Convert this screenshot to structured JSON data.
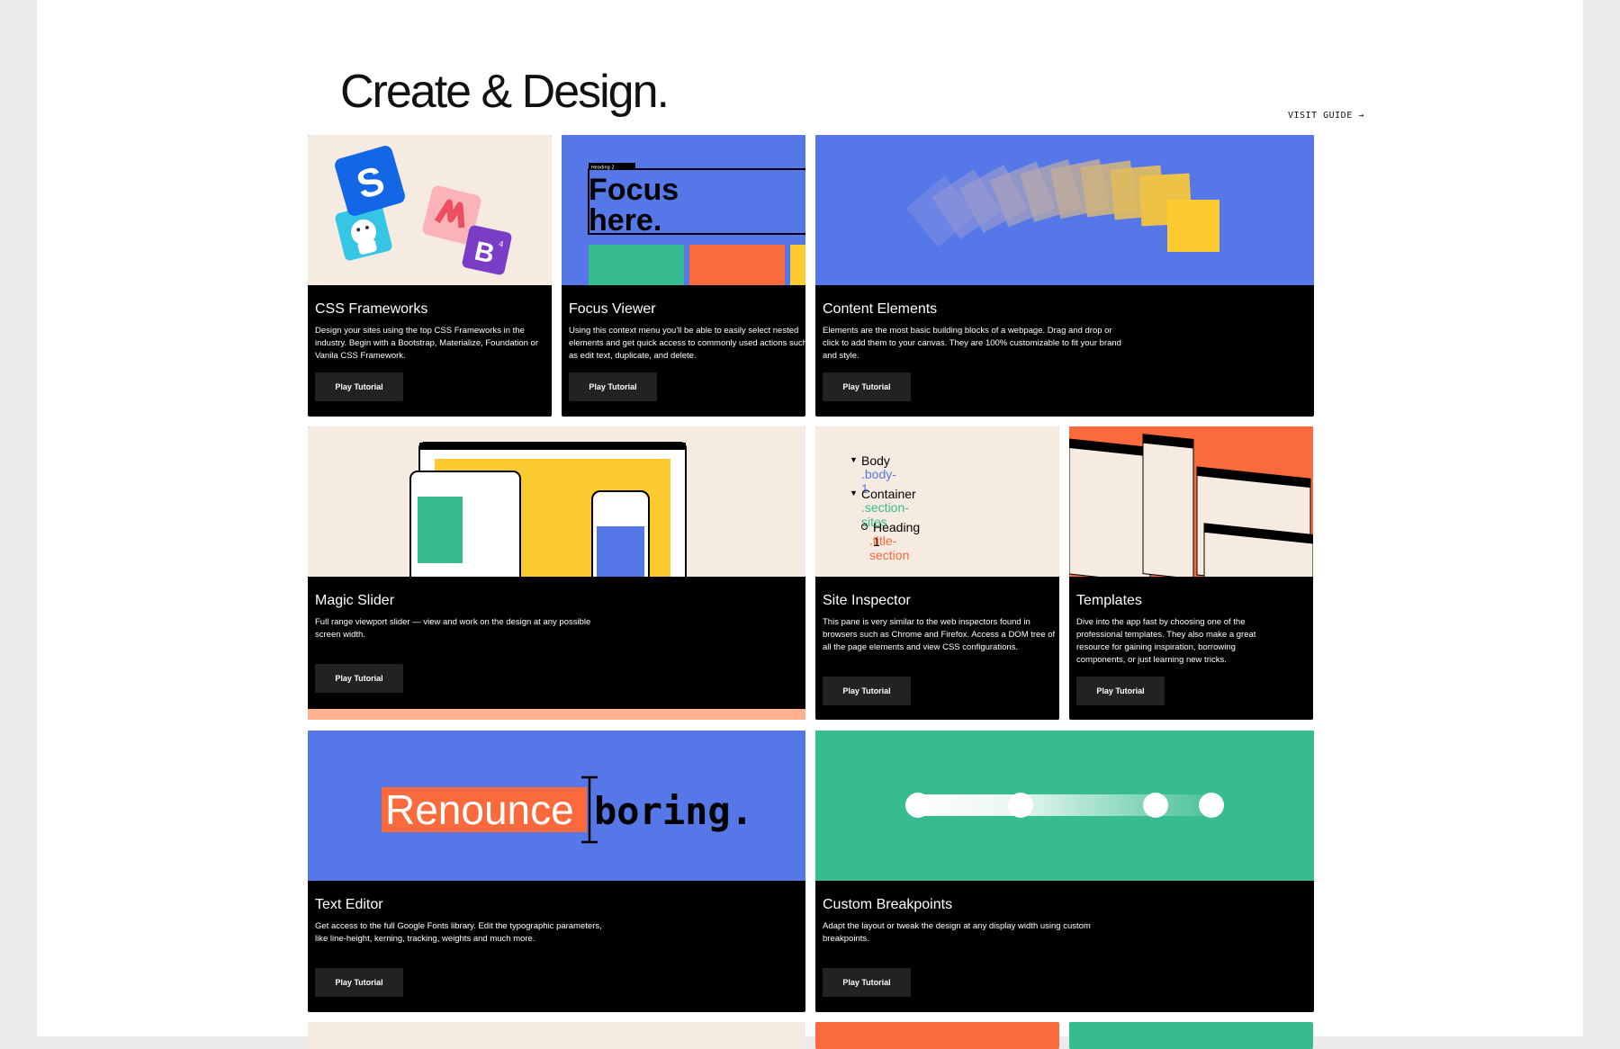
{
  "page": {
    "title": "Create & Design.",
    "visit_guide": "VISIT GUIDE →"
  },
  "cards": [
    {
      "title": "CSS Frameworks",
      "description": "Design your sites using the top CSS Frameworks in the industry. Begin with a Bootstrap, Materialize, Foundation or Vanila CSS Framework.",
      "button": "Play Tutorial",
      "hero": {
        "icons": [
          "S",
          "M",
          "B"
        ],
        "bootstrap_superscript": "4"
      }
    },
    {
      "title": "Focus Viewer",
      "description": "Using this context menu you'll be able to easily select nested elements and get quick access to commonly used actions such as edit text, duplicate, and delete.",
      "button": "Play Tutorial",
      "hero": {
        "focus_line1": "Focus",
        "focus_line2": "here.",
        "toolbar_label": "Heading 2"
      }
    },
    {
      "title": "Content Elements",
      "description": "Elements are the most basic building blocks of a webpage. Drag and drop or click to add them to your canvas. They are 100% customizable to fit your brand and style.",
      "button": "Play Tutorial"
    },
    {
      "title": "Magic Slider",
      "description": "Full range viewport slider — view and work on the design at any possible screen width.",
      "button": "Play Tutorial"
    },
    {
      "title": "Site Inspector",
      "description": "This pane is very similar to the web inspectors found in browsers such as Chrome and Firefox. Access a DOM tree of all the page elements and view CSS configurations.",
      "button": "Play Tutorial",
      "hero": {
        "tree": [
          {
            "name": "Body",
            "cls": ".body-1"
          },
          {
            "name": "Container",
            "cls": ".section-sites"
          },
          {
            "name": "Heading 1",
            "cls": ".title-section"
          }
        ]
      }
    },
    {
      "title": "Templates",
      "description": "Dive into the app fast by choosing one of the professional templates. They also make a great resource for gaining inspiration, borrowing components, or just learning new tricks.",
      "button": "Play Tutorial"
    },
    {
      "title": "Text Editor",
      "description": "Get access to the full Google Fonts library. Edit the typographic parameters, like line-height, kerning, tracking, weights and much more.",
      "button": "Play Tutorial",
      "hero": {
        "word1": "Renounce",
        "word2": "boring."
      }
    },
    {
      "title": "Custom Breakpoints",
      "description": "Adapt the layout or tweak the design at any display width using custom breakpoints.",
      "button": "Play Tutorial"
    }
  ],
  "colors": {
    "blue": "#5577e8",
    "orange": "#fa6a3c",
    "green": "#37bb91",
    "yellow": "#fdcb2f",
    "beige": "#f5ebe1",
    "peach": "#ffb18f",
    "card_background": "#000000"
  }
}
